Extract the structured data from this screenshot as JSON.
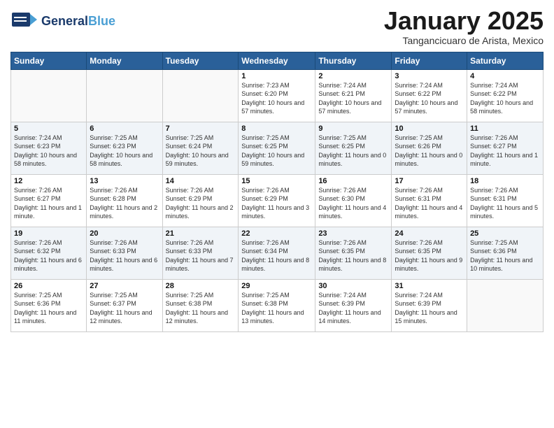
{
  "header": {
    "logo_general": "General",
    "logo_blue": "Blue",
    "month_title": "January 2025",
    "location": "Tangancicuaro de Arista, Mexico"
  },
  "days_of_week": [
    "Sunday",
    "Monday",
    "Tuesday",
    "Wednesday",
    "Thursday",
    "Friday",
    "Saturday"
  ],
  "weeks": [
    [
      {
        "day": "",
        "sunrise": "",
        "sunset": "",
        "daylight": ""
      },
      {
        "day": "",
        "sunrise": "",
        "sunset": "",
        "daylight": ""
      },
      {
        "day": "",
        "sunrise": "",
        "sunset": "",
        "daylight": ""
      },
      {
        "day": "1",
        "sunrise": "Sunrise: 7:23 AM",
        "sunset": "Sunset: 6:20 PM",
        "daylight": "Daylight: 10 hours and 57 minutes."
      },
      {
        "day": "2",
        "sunrise": "Sunrise: 7:24 AM",
        "sunset": "Sunset: 6:21 PM",
        "daylight": "Daylight: 10 hours and 57 minutes."
      },
      {
        "day": "3",
        "sunrise": "Sunrise: 7:24 AM",
        "sunset": "Sunset: 6:22 PM",
        "daylight": "Daylight: 10 hours and 57 minutes."
      },
      {
        "day": "4",
        "sunrise": "Sunrise: 7:24 AM",
        "sunset": "Sunset: 6:22 PM",
        "daylight": "Daylight: 10 hours and 58 minutes."
      }
    ],
    [
      {
        "day": "5",
        "sunrise": "Sunrise: 7:24 AM",
        "sunset": "Sunset: 6:23 PM",
        "daylight": "Daylight: 10 hours and 58 minutes."
      },
      {
        "day": "6",
        "sunrise": "Sunrise: 7:25 AM",
        "sunset": "Sunset: 6:23 PM",
        "daylight": "Daylight: 10 hours and 58 minutes."
      },
      {
        "day": "7",
        "sunrise": "Sunrise: 7:25 AM",
        "sunset": "Sunset: 6:24 PM",
        "daylight": "Daylight: 10 hours and 59 minutes."
      },
      {
        "day": "8",
        "sunrise": "Sunrise: 7:25 AM",
        "sunset": "Sunset: 6:25 PM",
        "daylight": "Daylight: 10 hours and 59 minutes."
      },
      {
        "day": "9",
        "sunrise": "Sunrise: 7:25 AM",
        "sunset": "Sunset: 6:25 PM",
        "daylight": "Daylight: 11 hours and 0 minutes."
      },
      {
        "day": "10",
        "sunrise": "Sunrise: 7:25 AM",
        "sunset": "Sunset: 6:26 PM",
        "daylight": "Daylight: 11 hours and 0 minutes."
      },
      {
        "day": "11",
        "sunrise": "Sunrise: 7:26 AM",
        "sunset": "Sunset: 6:27 PM",
        "daylight": "Daylight: 11 hours and 1 minute."
      }
    ],
    [
      {
        "day": "12",
        "sunrise": "Sunrise: 7:26 AM",
        "sunset": "Sunset: 6:27 PM",
        "daylight": "Daylight: 11 hours and 1 minute."
      },
      {
        "day": "13",
        "sunrise": "Sunrise: 7:26 AM",
        "sunset": "Sunset: 6:28 PM",
        "daylight": "Daylight: 11 hours and 2 minutes."
      },
      {
        "day": "14",
        "sunrise": "Sunrise: 7:26 AM",
        "sunset": "Sunset: 6:29 PM",
        "daylight": "Daylight: 11 hours and 2 minutes."
      },
      {
        "day": "15",
        "sunrise": "Sunrise: 7:26 AM",
        "sunset": "Sunset: 6:29 PM",
        "daylight": "Daylight: 11 hours and 3 minutes."
      },
      {
        "day": "16",
        "sunrise": "Sunrise: 7:26 AM",
        "sunset": "Sunset: 6:30 PM",
        "daylight": "Daylight: 11 hours and 4 minutes."
      },
      {
        "day": "17",
        "sunrise": "Sunrise: 7:26 AM",
        "sunset": "Sunset: 6:31 PM",
        "daylight": "Daylight: 11 hours and 4 minutes."
      },
      {
        "day": "18",
        "sunrise": "Sunrise: 7:26 AM",
        "sunset": "Sunset: 6:31 PM",
        "daylight": "Daylight: 11 hours and 5 minutes."
      }
    ],
    [
      {
        "day": "19",
        "sunrise": "Sunrise: 7:26 AM",
        "sunset": "Sunset: 6:32 PM",
        "daylight": "Daylight: 11 hours and 6 minutes."
      },
      {
        "day": "20",
        "sunrise": "Sunrise: 7:26 AM",
        "sunset": "Sunset: 6:33 PM",
        "daylight": "Daylight: 11 hours and 6 minutes."
      },
      {
        "day": "21",
        "sunrise": "Sunrise: 7:26 AM",
        "sunset": "Sunset: 6:33 PM",
        "daylight": "Daylight: 11 hours and 7 minutes."
      },
      {
        "day": "22",
        "sunrise": "Sunrise: 7:26 AM",
        "sunset": "Sunset: 6:34 PM",
        "daylight": "Daylight: 11 hours and 8 minutes."
      },
      {
        "day": "23",
        "sunrise": "Sunrise: 7:26 AM",
        "sunset": "Sunset: 6:35 PM",
        "daylight": "Daylight: 11 hours and 8 minutes."
      },
      {
        "day": "24",
        "sunrise": "Sunrise: 7:26 AM",
        "sunset": "Sunset: 6:35 PM",
        "daylight": "Daylight: 11 hours and 9 minutes."
      },
      {
        "day": "25",
        "sunrise": "Sunrise: 7:25 AM",
        "sunset": "Sunset: 6:36 PM",
        "daylight": "Daylight: 11 hours and 10 minutes."
      }
    ],
    [
      {
        "day": "26",
        "sunrise": "Sunrise: 7:25 AM",
        "sunset": "Sunset: 6:36 PM",
        "daylight": "Daylight: 11 hours and 11 minutes."
      },
      {
        "day": "27",
        "sunrise": "Sunrise: 7:25 AM",
        "sunset": "Sunset: 6:37 PM",
        "daylight": "Daylight: 11 hours and 12 minutes."
      },
      {
        "day": "28",
        "sunrise": "Sunrise: 7:25 AM",
        "sunset": "Sunset: 6:38 PM",
        "daylight": "Daylight: 11 hours and 12 minutes."
      },
      {
        "day": "29",
        "sunrise": "Sunrise: 7:25 AM",
        "sunset": "Sunset: 6:38 PM",
        "daylight": "Daylight: 11 hours and 13 minutes."
      },
      {
        "day": "30",
        "sunrise": "Sunrise: 7:24 AM",
        "sunset": "Sunset: 6:39 PM",
        "daylight": "Daylight: 11 hours and 14 minutes."
      },
      {
        "day": "31",
        "sunrise": "Sunrise: 7:24 AM",
        "sunset": "Sunset: 6:39 PM",
        "daylight": "Daylight: 11 hours and 15 minutes."
      },
      {
        "day": "",
        "sunrise": "",
        "sunset": "",
        "daylight": ""
      }
    ]
  ]
}
